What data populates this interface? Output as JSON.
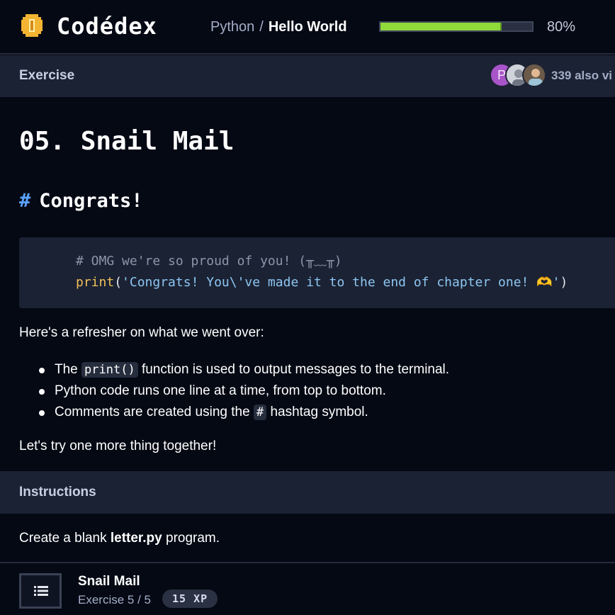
{
  "header": {
    "logo_text": "Codédex",
    "breadcrumb_course": "Python",
    "breadcrumb_separator": "/",
    "breadcrumb_current": "Hello World",
    "progress_value": 0.8,
    "progress_label": "80%"
  },
  "exercise_bar": {
    "title": "Exercise",
    "avatar_initial": "P",
    "viewers_text": "339 also vi"
  },
  "lesson": {
    "title": "05. Snail Mail",
    "section_hash": "#",
    "section_title": "Congrats!",
    "code": {
      "comment_line": "# OMG we're so proud of you! (╥﹏╥)",
      "fn": "print",
      "open": "(",
      "string": "'Congrats! You\\'ve made it to the end of chapter one! 🫶'",
      "close": ")"
    },
    "intro": "Here's a refresher on what we went over:",
    "bullets": [
      {
        "pre": "The ",
        "code": "print()",
        "post": " function is used to output messages to the terminal."
      },
      {
        "pre": "Python code runs one line at a time, from top to bottom.",
        "code": "",
        "post": ""
      },
      {
        "pre": "Comments are created using the ",
        "code": "#",
        "post": " hashtag symbol."
      }
    ],
    "outro": "Let's try one more thing together!"
  },
  "instructions": {
    "title": "Instructions",
    "text_pre": "Create a blank ",
    "text_bold": "letter.py",
    "text_post": " program."
  },
  "footer": {
    "title": "Snail Mail",
    "subtitle": "Exercise 5 / 5",
    "xp": "15 XP"
  },
  "colors": {
    "background": "#050914",
    "panel": "#1b2233",
    "progress_fill": "#8fd93a",
    "accent_hash": "#5aa3ff",
    "code_fn": "#f0c05a",
    "code_string": "#8cc6f2"
  }
}
